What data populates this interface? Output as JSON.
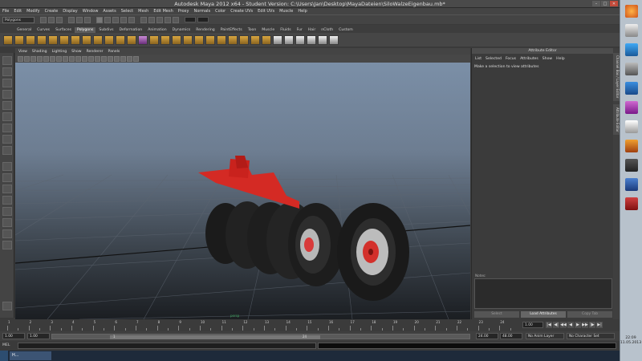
{
  "window": {
    "title": "Autodesk Maya 2012 x64 - Student Version: C:\\Users\\Jan\\Desktop\\MayaDateien\\SiloWalzeEigenbau.mb*",
    "controls": {
      "minimize": "–",
      "maximize": "□",
      "close": "✕"
    }
  },
  "menubar": {
    "items": [
      "File",
      "Edit",
      "Modify",
      "Create",
      "Display",
      "Window",
      "Assets",
      "Select",
      "Mesh",
      "Edit Mesh",
      "Proxy",
      "Normals",
      "Color",
      "Create UVs",
      "Edit UVs",
      "Muscle",
      "Help"
    ]
  },
  "statusline": {
    "mode": "Polygons"
  },
  "shelf": {
    "tabs": [
      "General",
      "Curves",
      "Surfaces",
      "Polygons",
      "Subdivs",
      "Deformation",
      "Animation",
      "Dynamics",
      "Rendering",
      "PaintEffects",
      "Toon",
      "Muscle",
      "Fluids",
      "Fur",
      "Hair",
      "nCloth",
      "Custom"
    ],
    "active": "Polygons"
  },
  "panel": {
    "menu": [
      "View",
      "Shading",
      "Lighting",
      "Show",
      "Renderer",
      "Panels"
    ],
    "camera_label": "persp"
  },
  "attribute_editor": {
    "header": "Attribute Editor",
    "menu": [
      "List",
      "Selected",
      "Focus",
      "Attributes",
      "Show",
      "Help"
    ],
    "message": "Make a selection to view attributes",
    "notes_label": "Notes:",
    "buttons": {
      "select": "Select",
      "load": "Load Attributes",
      "copy": "Copy Tab"
    },
    "side_tabs": [
      "Channel Box / Layer Editor",
      "Attribute Editor"
    ]
  },
  "timeline": {
    "ticks": [
      "1",
      "2",
      "3",
      "4",
      "5",
      "6",
      "7",
      "8",
      "9",
      "10",
      "11",
      "12",
      "13",
      "14",
      "15",
      "16",
      "17",
      "18",
      "19",
      "20",
      "21",
      "22",
      "23",
      "24"
    ],
    "current_frame": "1.00",
    "playback": {
      "go_start": "|◀",
      "step_back": "◀|",
      "key_back": "◀◀",
      "play_back": "◀",
      "play_fwd": "▶",
      "key_fwd": "▶▶",
      "step_fwd": "|▶",
      "go_end": "▶|"
    }
  },
  "range": {
    "start": "1.00",
    "playback_start": "1.00",
    "slider_start": "1",
    "slider_end": "24",
    "playback_end": "24.00",
    "end": "48.00",
    "anim_layer": "No Anim Layer",
    "char_set": "No Character Set"
  },
  "command": {
    "label": "MEL"
  },
  "taskbar": {
    "task": "H..."
  },
  "clock": {
    "time": "22:09",
    "date": "11.05.2013"
  }
}
